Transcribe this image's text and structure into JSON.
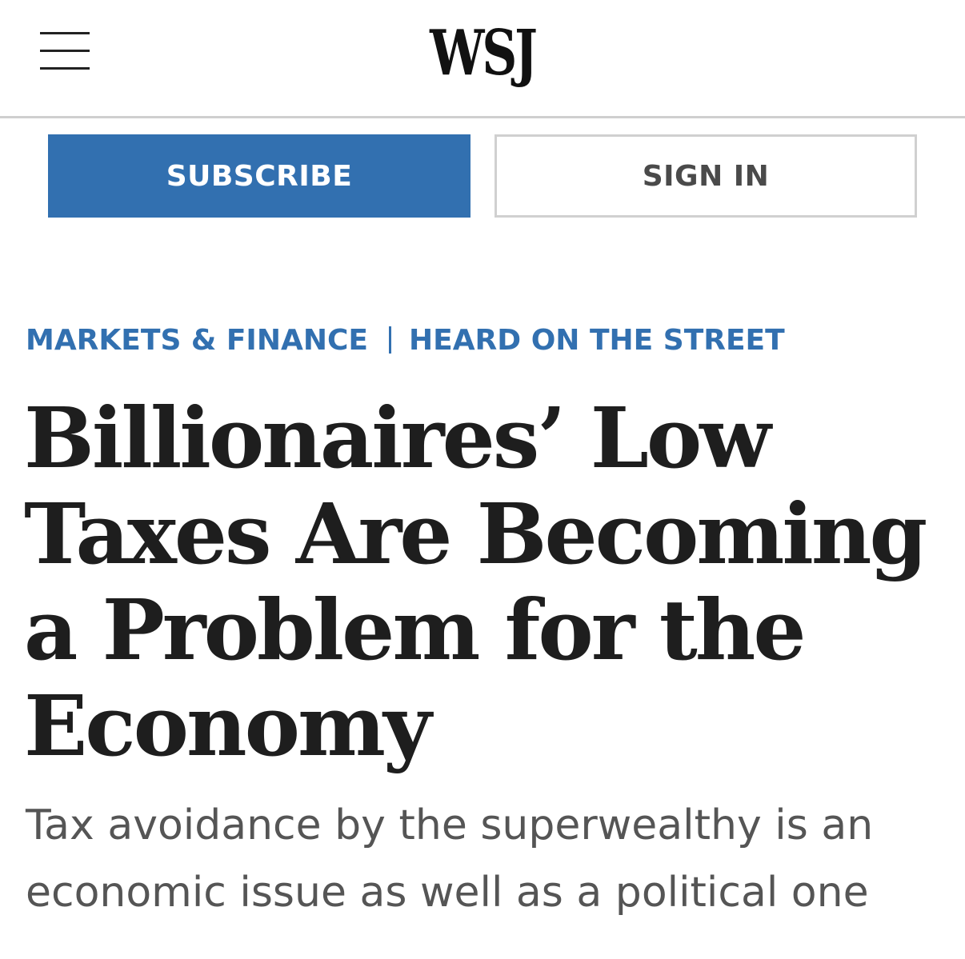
{
  "header": {
    "logo": "WSJ",
    "menu_icon": "hamburger-menu-icon"
  },
  "actions": {
    "subscribe_label": "SUBSCRIBE",
    "signin_label": "SIGN IN"
  },
  "breadcrumb": {
    "section": "MARKETS & FINANCE",
    "subsection": "HEARD ON THE STREET"
  },
  "article": {
    "headline": "Billionaires’ Low Taxes Are Becoming a Problem for the Economy",
    "dek": "Tax avoidance by the superwealthy is an economic issue as well as a political one"
  },
  "colors": {
    "accent": "#3270b0",
    "headline": "#1e1e1e",
    "dek": "#555555"
  }
}
